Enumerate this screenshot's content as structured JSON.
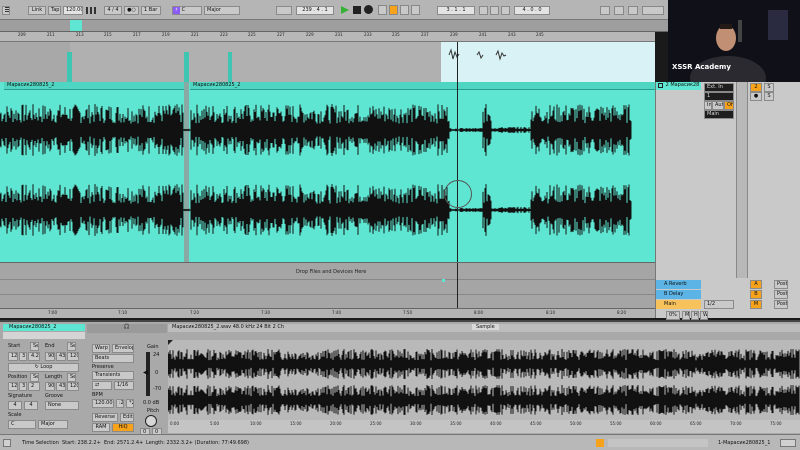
{
  "transport": {
    "link": "Link",
    "tap": "Tap",
    "tempo": "120.00",
    "meter": "4 / 4",
    "metro": "1 Bar",
    "key": "C",
    "scale": "Major",
    "position": "239 . 4 . 1",
    "loop_start": "3 . 1 . 1",
    "loop_length": "4 . 0 . 0",
    "play_icon": "play-icon",
    "stop_icon": "stop-icon",
    "record_icon": "record-icon"
  },
  "ruler_bars": [
    "209",
    "211",
    "213",
    "215",
    "217",
    "219",
    "221",
    "223",
    "225",
    "227",
    "229",
    "231",
    "233",
    "235",
    "237",
    "239",
    "241",
    "243",
    "245"
  ],
  "time_ticks": [
    "7:00",
    "7:10",
    "7:20",
    "7:30",
    "7:40",
    "7:50",
    "8:00",
    "8:10",
    "8:20"
  ],
  "track": {
    "clip_name_1": "Марасик280825_2",
    "clip_name_2": "Марасик280825_2",
    "drop_text": "Drop Files and Devices Here",
    "track_name": "2 Марасик28",
    "input_1": "Ext. In",
    "input_2": "1",
    "monitor_in": "In",
    "monitor_auto": "Auto",
    "monitor_off": "Off",
    "output": "Main",
    "track_number": "2",
    "sends_label": "S",
    "arm_label": "●"
  },
  "returns": {
    "a_reverb": "A Reverb",
    "b_delay": "B Delay",
    "main": "Main",
    "main_level": "1/2",
    "a_letter": "A",
    "b_letter": "B",
    "m_letter": "M",
    "post": "Post",
    "tempo_small": "0%",
    "m_button": "M",
    "h_button": "H",
    "w_button": "W"
  },
  "video": {
    "overlay": "XSSR Academy"
  },
  "clip_view": {
    "header": "Марасик280825_2",
    "file_info": "Марасик280825_2.wav 48.0 kHz 24 Bit 2 Ch",
    "sample_tab": "Sample",
    "start_label": "Start",
    "end_label": "End",
    "set_1": "Set",
    "set_2": "Set",
    "start_vals": [
      "121",
      "3",
      "4.2"
    ],
    "end_vals": [
      "90",
      "43",
      "120"
    ],
    "loop": "Loop",
    "position_label": "Position",
    "length_label": "Length",
    "set_3": "Set",
    "set_4": "Set",
    "pos_vals": [
      "121",
      "3",
      "2"
    ],
    "len_vals": [
      "90",
      "43",
      "120"
    ],
    "signature_label": "Signature",
    "sig_vals": [
      "4",
      "4"
    ],
    "groove_label": "Groove",
    "groove_value": "None",
    "scale_label": "Scale",
    "scale_key": "C",
    "scale_type": "Major",
    "warp": "Warp",
    "envelope": "Envelope",
    "beats": "Beats",
    "preserve_label": "Preserve",
    "preserve_value": "Transients",
    "grain": "1/16",
    "bpm_label": "BPM",
    "bpm_value": "120.00",
    "half": ":2",
    "double": "*2",
    "reverse": "Reverse",
    "edit": "Edit",
    "ram": "RAM",
    "hiq": "HiQ",
    "vol_val": "0",
    "gain_label": "Gain",
    "gain_ticks": [
      "24",
      "0",
      "-70"
    ],
    "gain_value": "0.0 dB",
    "pitch_label": "Pitch",
    "pitch_vals": [
      "0",
      "0"
    ],
    "bottom_ruler": [
      "0:00",
      "5:00",
      "10:00",
      "15:00",
      "20:00",
      "25:00",
      "30:00",
      "35:00",
      "40:00",
      "45:00",
      "50:00",
      "55:00",
      "60:00",
      "65:00",
      "70:00",
      "75:00"
    ]
  },
  "status": {
    "selection": "Time Selection",
    "start": "Start: 238.2.2+",
    "end": "End: 2571.2.4+",
    "length": "Length: 2332.3.2+ (Duration: 77:49.698)",
    "track_name": "1-Марасик280825_1"
  },
  "colors": {
    "clip": "#5fe6d2",
    "accent": "#f6a21a",
    "header": "#4a4a4a"
  }
}
